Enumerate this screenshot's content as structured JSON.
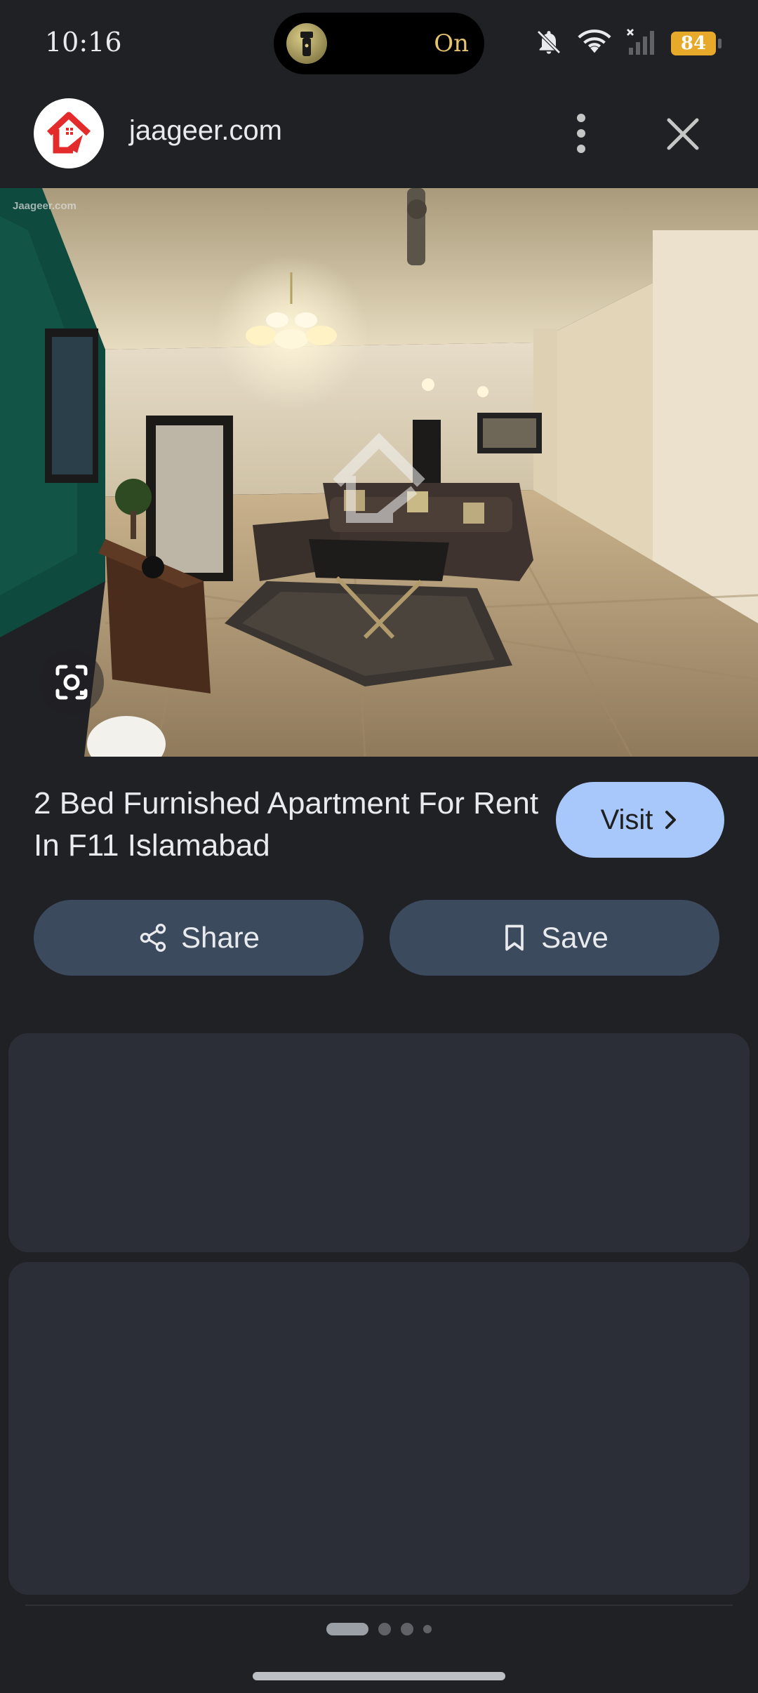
{
  "status_bar": {
    "time": "10:16",
    "flashlight_state": "On",
    "battery": "84",
    "icons": [
      "notifications-off-icon",
      "wifi-icon",
      "signal-icon"
    ]
  },
  "header": {
    "site": "jaageer.com",
    "logo_icon": "jaageer-logo",
    "more_icon": "more-vert-icon",
    "close_icon": "close-icon"
  },
  "image": {
    "watermark": "Jaageer.com",
    "lens_icon": "google-lens-icon"
  },
  "result": {
    "title": "2 Bed Furnished Apartment For Rent In F11 Islamabad",
    "visit_label": "Visit"
  },
  "actions": {
    "share_label": "Share",
    "save_label": "Save"
  },
  "pager": {
    "pages": 4,
    "current": 1
  },
  "colors": {
    "background": "#202124",
    "visit_button": "#a8c7fa",
    "action_button": "#3c4a5d",
    "card": "#2b2e36",
    "brand_red": "#e32b2b",
    "battery": "#e6a92a"
  }
}
